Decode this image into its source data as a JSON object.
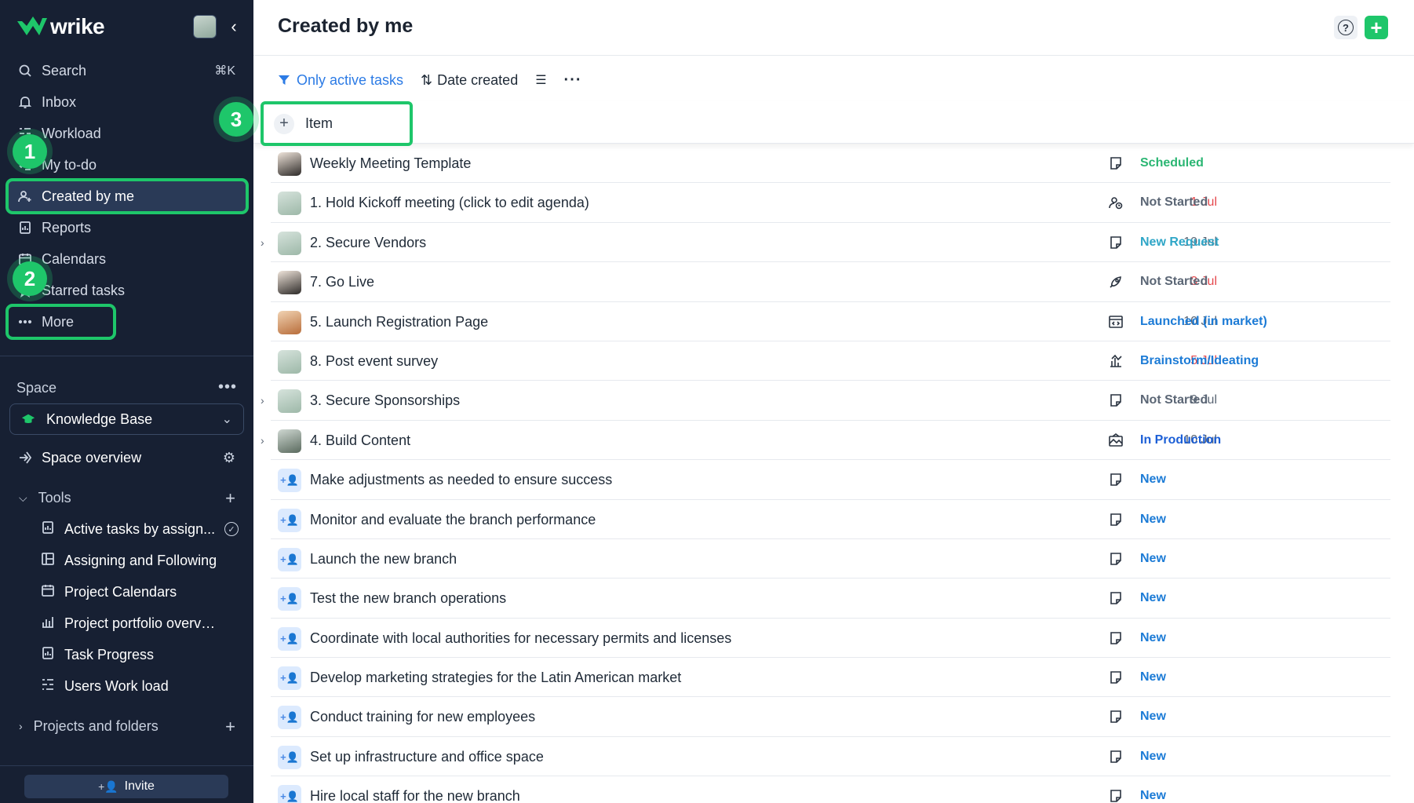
{
  "app": {
    "brand": "wrike"
  },
  "sidebar": {
    "nav": [
      {
        "label": "Search",
        "icon": "search-icon",
        "shortcut": "⌘K"
      },
      {
        "label": "Inbox",
        "icon": "bell-icon"
      },
      {
        "label": "Workload",
        "icon": "workload-icon"
      },
      {
        "label": "My to-do",
        "icon": "checklist-icon"
      },
      {
        "label": "Created by me",
        "icon": "user-created-icon",
        "active": true
      },
      {
        "label": "Reports",
        "icon": "report-icon"
      },
      {
        "label": "Calendars",
        "icon": "calendar-icon"
      },
      {
        "label": "Starred tasks",
        "icon": "star-icon"
      },
      {
        "label": "More",
        "icon": "more-dots-icon"
      }
    ],
    "space_label": "Space",
    "space_selected": "Knowledge Base",
    "space_overview": "Space overview",
    "tools_label": "Tools",
    "tools": [
      {
        "label": "Active tasks by assign...",
        "icon": "report-icon"
      },
      {
        "label": "Assigning and Following",
        "icon": "board-icon"
      },
      {
        "label": "Project Calendars",
        "icon": "calendar-icon"
      },
      {
        "label": "Project portfolio overview",
        "icon": "portfolio-icon"
      },
      {
        "label": "Task Progress",
        "icon": "report-icon"
      },
      {
        "label": "Users Work load",
        "icon": "workload-icon"
      }
    ],
    "projects_label": "Projects and folders",
    "invite_label": "Invite"
  },
  "steps": {
    "one": "1",
    "two": "2",
    "three": "3"
  },
  "main": {
    "title": "Created by me",
    "toolbar": {
      "filter_label": "Only active tasks",
      "sort_label": "Date created"
    },
    "add_item_label": "Item"
  },
  "tasks": [
    {
      "title": "Weekly Meeting Template",
      "date": "",
      "status": "Scheduled",
      "status_color": "#2bb673",
      "icon": "task-icon",
      "avatar": "av-e",
      "expand": false
    },
    {
      "title": "1. Hold Kickoff meeting (click to edit agenda)",
      "date": "1 Jul",
      "overdue": true,
      "status": "Not Started",
      "status_color": "#5b6675",
      "icon": "meeting-icon",
      "avatar": "av-a",
      "expand": false
    },
    {
      "title": "2. Secure Vendors",
      "date": "19 Jul",
      "status": "New Request",
      "status_color": "#2fa6c7",
      "icon": "task-icon",
      "avatar": "av-a",
      "expand": true
    },
    {
      "title": "7. Go Live",
      "date": "3 Jul",
      "overdue": true,
      "status": "Not Started",
      "status_color": "#5b6675",
      "icon": "rocket-icon",
      "avatar": "av-e",
      "expand": false
    },
    {
      "title": "5. Launch Registration Page",
      "date": "10 Jul",
      "status": "Launched (in market)",
      "status_color": "#1c7bd6",
      "icon": "code-icon",
      "avatar": "av-c",
      "expand": false
    },
    {
      "title": "8. Post event survey",
      "date": "5 Jul",
      "overdue": true,
      "status": "Brainstorm/Ideating",
      "status_color": "#1c7bd6",
      "icon": "chart-icon",
      "avatar": "av-a",
      "expand": false
    },
    {
      "title": "3. Secure Sponsorships",
      "date": "9 Jul",
      "status": "Not Started",
      "status_color": "#5b6675",
      "icon": "task-icon",
      "avatar": "av-a",
      "expand": true
    },
    {
      "title": "4. Build Content",
      "date": "10 Jul",
      "status": "In Production",
      "status_color": "#1c5fd6",
      "icon": "image-icon",
      "avatar": "av-d",
      "expand": true
    },
    {
      "title": "Make adjustments as needed to ensure success",
      "date": "",
      "status": "New",
      "status_color": "#1c7bd6",
      "icon": "task-icon",
      "avatar": "av-add",
      "expand": false
    },
    {
      "title": "Monitor and evaluate the branch performance",
      "date": "",
      "status": "New",
      "status_color": "#1c7bd6",
      "icon": "task-icon",
      "avatar": "av-add",
      "expand": false
    },
    {
      "title": "Launch the new branch",
      "date": "",
      "status": "New",
      "status_color": "#1c7bd6",
      "icon": "task-icon",
      "avatar": "av-add",
      "expand": false
    },
    {
      "title": "Test the new branch operations",
      "date": "",
      "status": "New",
      "status_color": "#1c7bd6",
      "icon": "task-icon",
      "avatar": "av-add",
      "expand": false
    },
    {
      "title": "Coordinate with local authorities for necessary permits and licenses",
      "date": "",
      "status": "New",
      "status_color": "#1c7bd6",
      "icon": "task-icon",
      "avatar": "av-add",
      "expand": false
    },
    {
      "title": "Develop marketing strategies for the Latin American market",
      "date": "",
      "status": "New",
      "status_color": "#1c7bd6",
      "icon": "task-icon",
      "avatar": "av-add",
      "expand": false
    },
    {
      "title": "Conduct training for new employees",
      "date": "",
      "status": "New",
      "status_color": "#1c7bd6",
      "icon": "task-icon",
      "avatar": "av-add",
      "expand": false
    },
    {
      "title": "Set up infrastructure and office space",
      "date": "",
      "status": "New",
      "status_color": "#1c7bd6",
      "icon": "task-icon",
      "avatar": "av-add",
      "expand": false
    },
    {
      "title": "Hire local staff for the new branch",
      "date": "",
      "status": "New",
      "status_color": "#1c7bd6",
      "icon": "task-icon",
      "avatar": "av-add",
      "expand": false
    }
  ]
}
